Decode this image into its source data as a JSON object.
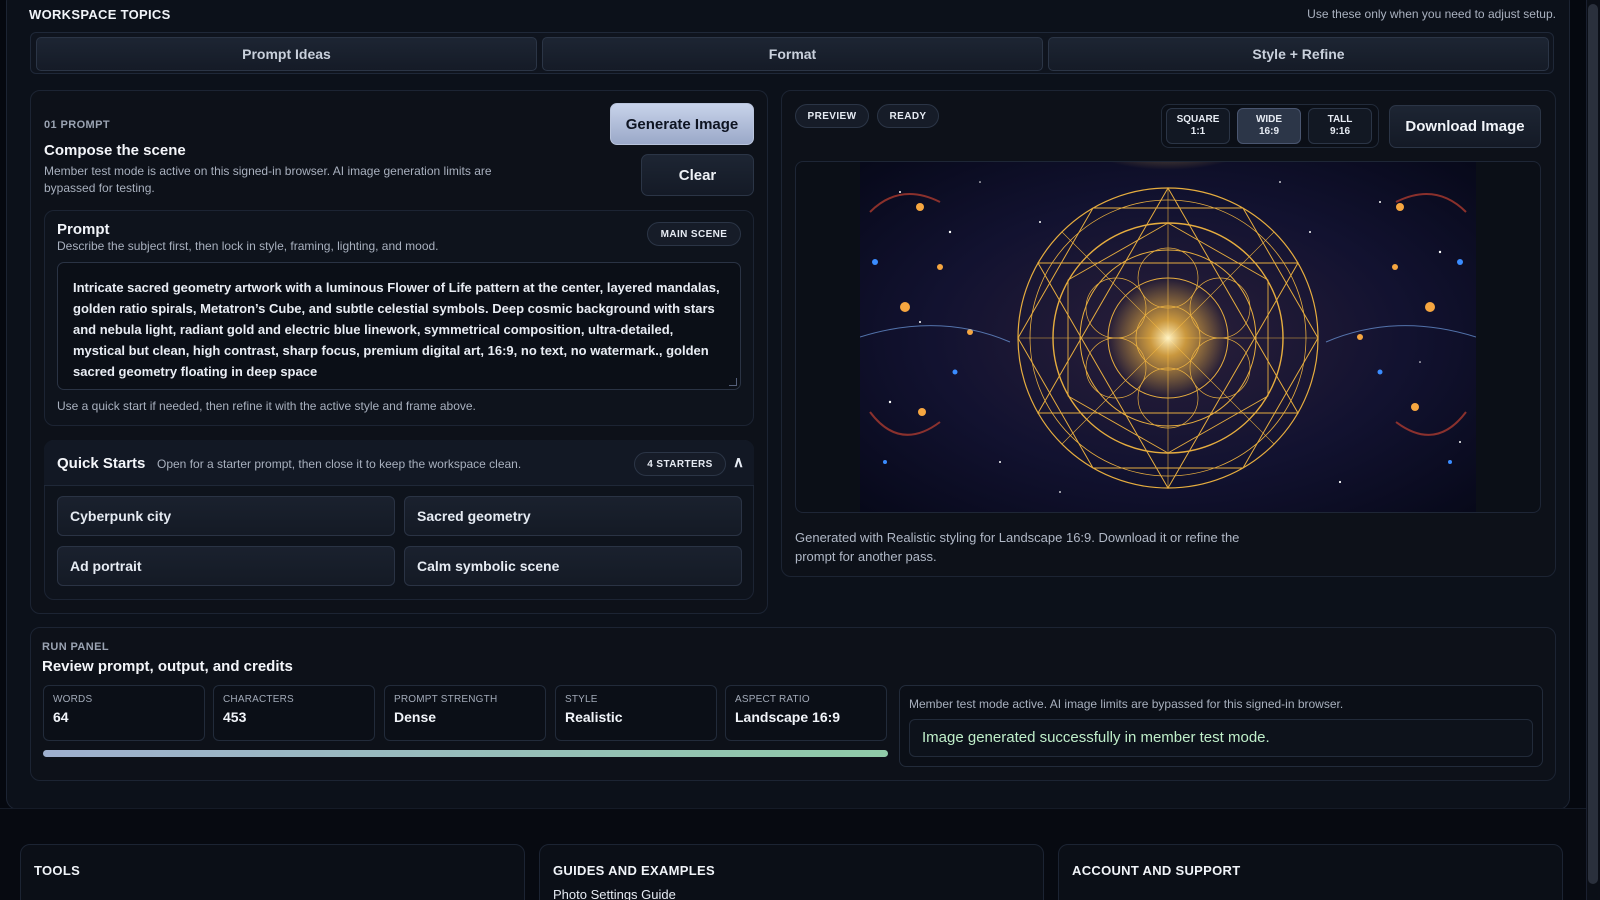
{
  "workspace": {
    "title": "WORKSPACE TOPICS",
    "hint": "Use these only when you need to adjust setup.",
    "tabs": [
      "Prompt Ideas",
      "Format",
      "Style + Refine"
    ]
  },
  "compose": {
    "step": "01 PROMPT",
    "title": "Compose the scene",
    "description": "Member test mode is active on this signed-in browser. AI image generation limits are bypassed for testing.",
    "generate_label": "Generate Image",
    "clear_label": "Clear",
    "prompt": {
      "label": "Prompt",
      "hint": "Describe the subject first, then lock in style, framing, lighting, and mood.",
      "badge": "MAIN SCENE",
      "value": "Intricate sacred geometry artwork with a luminous Flower of Life pattern at the center, layered mandalas, golden ratio spirals, Metatron’s Cube, and subtle celestial symbols. Deep cosmic background with stars and nebula light, radiant gold and electric blue linework, symmetrical composition, ultra-detailed, mystical but clean, high contrast, sharp focus, premium digital art, 16:9, no text, no watermark., golden sacred geometry floating in deep space",
      "footer": "Use a quick start if needed, then refine it with the active style and frame above."
    },
    "quick_starts": {
      "title": "Quick Starts",
      "hint": "Open for a starter prompt, then close it to keep the workspace clean.",
      "badge": "4 STARTERS",
      "toggle": "∧",
      "items": [
        "Cyberpunk city",
        "Sacred geometry",
        "Ad portrait",
        "Calm symbolic scene"
      ]
    }
  },
  "preview": {
    "pills": [
      "PREVIEW",
      "READY"
    ],
    "ratios": [
      {
        "name": "SQUARE",
        "ratio": "1:1"
      },
      {
        "name": "WIDE",
        "ratio": "16:9"
      },
      {
        "name": "TALL",
        "ratio": "9:16"
      }
    ],
    "download_label": "Download Image",
    "caption": "Generated with Realistic styling for Landscape 16:9. Download it or refine the prompt for another pass.",
    "colors": {
      "gold": "#f2b640",
      "blue": "#3a8cff",
      "bg": "#0a0c1e"
    }
  },
  "run_panel": {
    "step": "RUN PANEL",
    "title": "Review prompt, output, and credits",
    "stats": [
      {
        "label": "WORDS",
        "value": "64"
      },
      {
        "label": "CHARACTERS",
        "value": "453"
      },
      {
        "label": "PROMPT STRENGTH",
        "value": "Dense"
      },
      {
        "label": "STYLE",
        "value": "Realistic"
      },
      {
        "label": "ASPECT RATIO",
        "value": "Landscape 16:9"
      }
    ],
    "progress": 1.0,
    "notice": "Member test mode active. AI image limits are bypassed for this signed-in browser.",
    "status": "Image generated successfully in member test mode."
  },
  "footer": {
    "sections": [
      {
        "title": "TOOLS",
        "links": []
      },
      {
        "title": "GUIDES AND EXAMPLES",
        "links": [
          "Photo Settings Guide"
        ]
      },
      {
        "title": "ACCOUNT AND SUPPORT",
        "links": []
      }
    ]
  }
}
